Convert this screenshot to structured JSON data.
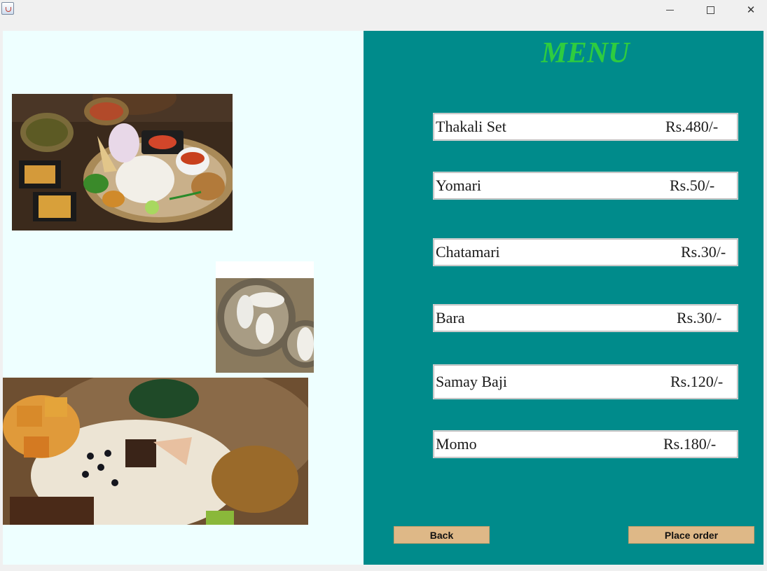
{
  "window": {
    "app_icon": "java-cup-icon",
    "controls": [
      "minimize-icon",
      "maximize-icon",
      "close-icon"
    ]
  },
  "menu": {
    "title": "MENU",
    "items": [
      {
        "name": "Thakali Set",
        "price": "Rs.480/-"
      },
      {
        "name": "Yomari",
        "price": "Rs.50/-"
      },
      {
        "name": "Chatamari",
        "price": "Rs.30/-"
      },
      {
        "name": "Bara",
        "price": "Rs.30/-"
      },
      {
        "name": "Samay Baji",
        "price": "Rs.120/-"
      },
      {
        "name": "Momo",
        "price": "Rs.180/-"
      }
    ]
  },
  "buttons": {
    "back": "Back",
    "place_order": "Place order"
  },
  "images": [
    {
      "depicts": "thakali-set-photo"
    },
    {
      "depicts": "yomari-photo"
    },
    {
      "depicts": "samay-baji-photo"
    }
  ],
  "colors": {
    "left_panel_bg": "#eeffff",
    "right_panel_bg": "#008b8b",
    "title_color": "#2ecc40",
    "button_bg": "#deb887"
  }
}
